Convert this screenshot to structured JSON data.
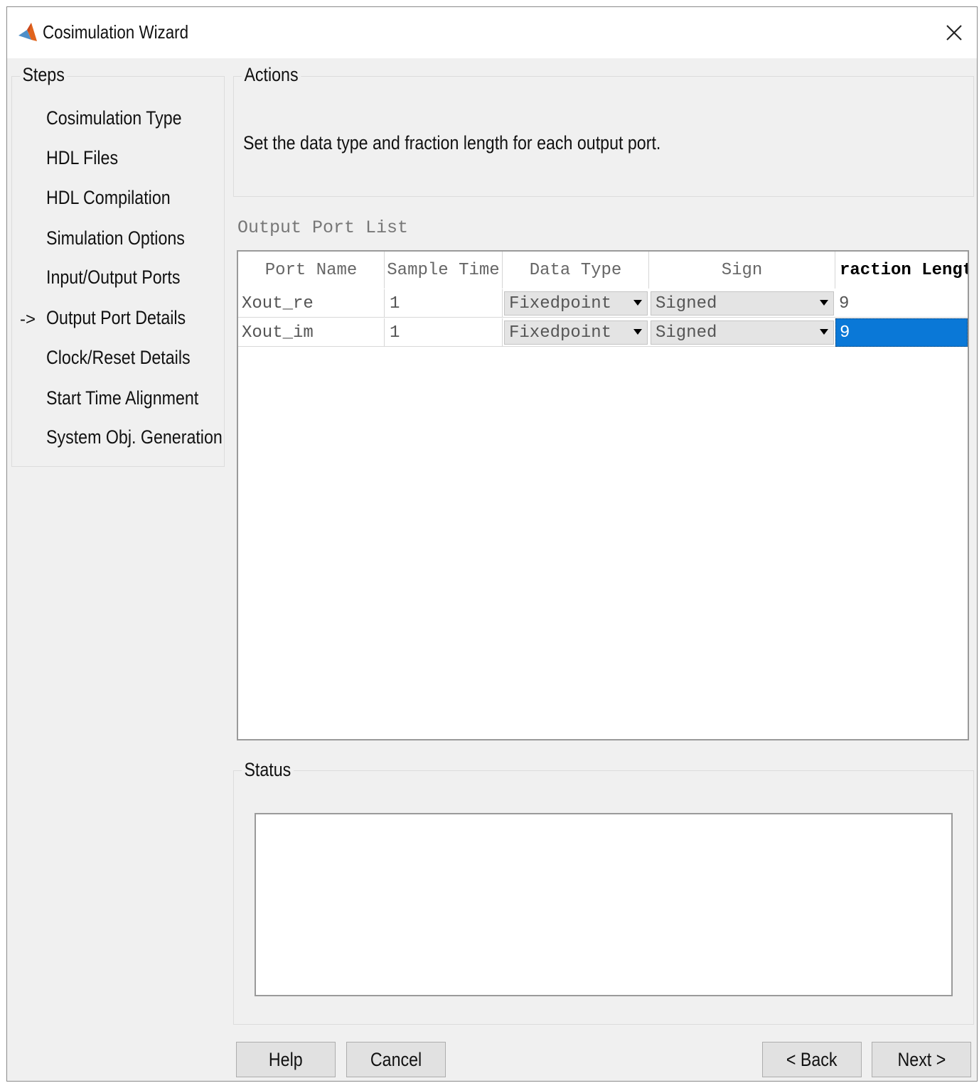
{
  "window": {
    "title": "Cosimulation Wizard"
  },
  "steps": {
    "label": "Steps",
    "current_marker": "->",
    "items": [
      {
        "label": "Cosimulation Type"
      },
      {
        "label": "HDL Files"
      },
      {
        "label": "HDL Compilation"
      },
      {
        "label": "Simulation Options"
      },
      {
        "label": "Input/Output Ports"
      },
      {
        "label": "Output Port Details"
      },
      {
        "label": "Clock/Reset Details"
      },
      {
        "label": "Start Time Alignment"
      },
      {
        "label": "System Obj. Generation"
      }
    ]
  },
  "actions": {
    "label": "Actions",
    "instruction": "Set the data type and fraction length for each output port."
  },
  "port_list": {
    "title": "Output Port List",
    "columns": [
      "Port Name",
      "Sample Time",
      "Data Type",
      "Sign",
      "raction Lengt"
    ],
    "rows": [
      {
        "port_name": "Xout_re",
        "sample_time": "1",
        "data_type": "Fixedpoint",
        "sign": "Signed",
        "fraction_length": "9"
      },
      {
        "port_name": "Xout_im",
        "sample_time": "1",
        "data_type": "Fixedpoint",
        "sign": "Signed",
        "fraction_length": "9"
      }
    ]
  },
  "status": {
    "label": "Status",
    "text": ""
  },
  "buttons": {
    "help": "Help",
    "cancel": "Cancel",
    "back": "< Back",
    "next": "Next >"
  },
  "colors": {
    "selection": "#0a78d7",
    "dialog_bg": "#f0f0f0"
  },
  "icons": {
    "app": "matlab-logo-icon",
    "close": "close-icon",
    "dropdown": "dropdown-arrow-icon"
  }
}
